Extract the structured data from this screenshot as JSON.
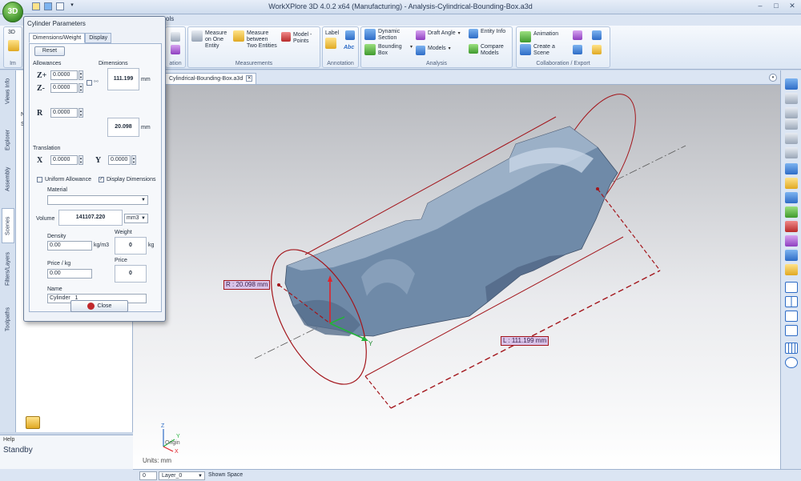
{
  "window": {
    "orb_label": "3D",
    "title": "WorkXPlore 3D 4.0.2 x64 (Manufacturing) - Analysis-Cylindrical-Bounding-Box.a3d",
    "controls": {
      "minimize": "–",
      "maximize": "□",
      "close": "✕"
    }
  },
  "ribbon_tabs": {
    "visible_fragment": "ols"
  },
  "ribbon": {
    "left_button": {
      "label": "3D",
      "group_fragment": "Im"
    },
    "view_group_fragment": "ation",
    "measurements": {
      "group_label": "Measurements",
      "measure_one": "Measure on One Entity",
      "measure_two": "Measure between Two Entities",
      "model_points": "Model - Points"
    },
    "annotation": {
      "group_label": "Annotation",
      "label": "Label",
      "abc": "Abc"
    },
    "analysis": {
      "group_label": "Analysis",
      "dynamic_section": "Dynamic Section",
      "bounding_box": "Bounding Box",
      "draft_angle": "Draft Angle",
      "models": "Models",
      "entity_info": "Entity Info",
      "compare_models": "Compare Models"
    },
    "collaboration": {
      "group_label": "Collaboration / Export",
      "animation": "Animation",
      "create_scene": "Create a Scene"
    }
  },
  "left_tabs": [
    "Views Info",
    "Explorer",
    "Assembly",
    "Scenes",
    "Filters/Layers",
    "Toolpaths"
  ],
  "left_panel": {
    "tree_fragments": [
      "Na",
      "Sh"
    ]
  },
  "help": {
    "title": "Help",
    "status": "Standby"
  },
  "dialog": {
    "title": "Cylinder Parameters",
    "tabs": [
      "Dimensions/Weight",
      "Display"
    ],
    "reset_label": "Reset",
    "allowances_label": "Allowances",
    "dimensions_label": "Dimensions",
    "zplus_label": "Z+",
    "zplus_value": "0.0000",
    "zminus_label": "Z-",
    "zminus_value": "0.0000",
    "r_label": "R",
    "r_value": "0.0000",
    "length_dim": "111.199",
    "radius_dim": "20.098",
    "mm_unit": "mm",
    "translation_label": "Translation",
    "x_label": "X",
    "x_value": "0.0000",
    "y_label": "Y",
    "y_value": "0.0000",
    "uniform_allowance_label": "Uniform Allowance",
    "uniform_allowance_checked": false,
    "display_dimensions_label": "Display Dimensions",
    "display_dimensions_checked": true,
    "material_label": "Material",
    "material_value": "",
    "volume_label": "Volume",
    "volume_value": "141107.220",
    "volume_unit": "mm3",
    "density_label": "Density",
    "density_value": "0.00",
    "density_unit": "kg/m3",
    "weight_label": "Weight",
    "weight_value": "0",
    "weight_unit": "kg",
    "price_kg_label": "Price / kg",
    "price_kg_value": "0.00",
    "price_label": "Price",
    "price_value": "0",
    "name_label": "Name",
    "name_value": "Cylinder _1",
    "close_label": "Close"
  },
  "document": {
    "tab_label": "Cylindrical-Bounding-Box.a3d",
    "close_glyph": "✕"
  },
  "viewport": {
    "radius_annotation": "R : 20.098 mm",
    "length_annotation": "L : 111.199 mm",
    "axis_y": "Y",
    "axis_z": "Z",
    "axis_x": "X",
    "origin_label": "Origin",
    "units_label": "Units: mm",
    "colors": {
      "part": "#6f8aa8",
      "cylinder": "#a3151b",
      "axis_red": "#e0232b",
      "axis_green": "#23b33a"
    }
  },
  "status_bar": {
    "field1": "0",
    "layer": "Layer_0",
    "shown_space": "Shown Space"
  }
}
